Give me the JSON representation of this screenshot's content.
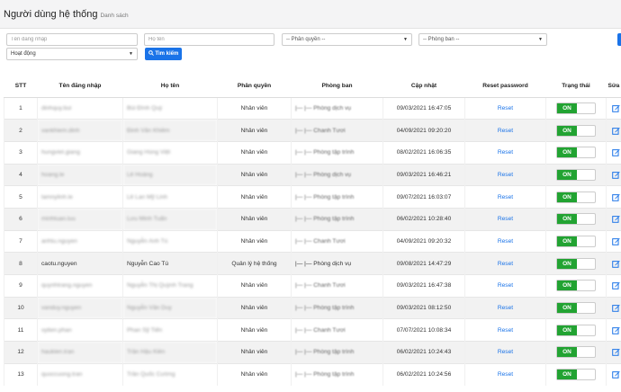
{
  "header": {
    "title": "Người dùng hệ thống",
    "subtitle": "Danh sách"
  },
  "filters": {
    "username_placeholder": "Tên đăng nhập",
    "fullname_placeholder": "Họ tên",
    "role_select": "-- Phân quyền --",
    "department_select": "-- Phòng ban --",
    "status_select": "Hoạt động",
    "search_label": "Tìm kiếm"
  },
  "table": {
    "headers": [
      "STT",
      "Tên đăng nhập",
      "Họ tên",
      "Phân quyền",
      "Phòng ban",
      "Cập nhật",
      "Reset password",
      "Trạng thái",
      "Sửa"
    ],
    "reset_label": "Reset",
    "status_label": "ON",
    "rows": [
      {
        "stt": "1",
        "username": "dinhquy.bui",
        "fullname": "Bùi Đình Quý",
        "role": "Nhân viên",
        "department": "|— |— Phòng dịch vụ",
        "updated": "09/03/2021 16:47:05"
      },
      {
        "stt": "2",
        "username": "vankhiem.dinh",
        "fullname": "Đinh Văn Khiêm",
        "role": "Nhân viên",
        "department": "|— |— Chanh Tươi",
        "updated": "04/09/2021 09:20:20"
      },
      {
        "stt": "3",
        "username": "hungviet.giang",
        "fullname": "Giang Hùng Việt",
        "role": "Nhân viên",
        "department": "|— |— Phòng tập trình",
        "updated": "08/02/2021 16:06:35"
      },
      {
        "stt": "4",
        "username": "hoang.le",
        "fullname": "Lê Hoàng",
        "role": "Nhân viên",
        "department": "|— |— Phòng dịch vụ",
        "updated": "09/03/2021 16:46:21"
      },
      {
        "stt": "5",
        "username": "lamnylinh.le",
        "fullname": "Lê Lan Mỹ Linh",
        "role": "Nhân viên",
        "department": "|— |— Phòng tập trình",
        "updated": "09/07/2021 16:03:07"
      },
      {
        "stt": "6",
        "username": "minhtuan.luu",
        "fullname": "Lưu Minh Tuấn",
        "role": "Nhân viên",
        "department": "|— |— Phòng tập trình",
        "updated": "06/02/2021 10:28:40"
      },
      {
        "stt": "7",
        "username": "anhtu.nguyen",
        "fullname": "Nguyễn Anh Tú",
        "role": "Nhân viên",
        "department": "|— |— Chanh Tươi",
        "updated": "04/09/2021 09:20:32"
      },
      {
        "stt": "8",
        "username": "caotu.nguyen",
        "fullname": "Nguyễn Cao Tú",
        "role": "Quản lý hệ thống",
        "department": "|— |— Phòng dịch vụ",
        "updated": "09/08/2021 14:47:29"
      },
      {
        "stt": "9",
        "username": "quynhtrang.nguyen",
        "fullname": "Nguyễn Thị Quỳnh Trang",
        "role": "Nhân viên",
        "department": "|— |— Chanh Tươi",
        "updated": "09/03/2021 16:47:38"
      },
      {
        "stt": "10",
        "username": "vanduy.nguyen",
        "fullname": "Nguyễn Văn Duy",
        "role": "Nhân viên",
        "department": "|— |— Phòng tập trình",
        "updated": "09/03/2021 08:12:50"
      },
      {
        "stt": "11",
        "username": "vytien.phan",
        "fullname": "Phan Sỹ Tiến",
        "role": "Nhân viên",
        "department": "|— |— Chanh Tươi",
        "updated": "07/07/2021 10:08:34"
      },
      {
        "stt": "12",
        "username": "haukien.tran",
        "fullname": "Trần Hậu Kiên",
        "role": "Nhân viên",
        "department": "|— |— Phòng tập trình",
        "updated": "06/02/2021 10:24:43"
      },
      {
        "stt": "13",
        "username": "quoccuong.tran",
        "fullname": "Trần Quốc Cường",
        "role": "Nhân viên",
        "department": "|— |— Phòng tập trình",
        "updated": "06/02/2021 10:24:56"
      }
    ]
  },
  "colors": {
    "primary": "#1a73e8",
    "on": "#22a332",
    "header_bg": "#f4f4f5"
  },
  "icons": {
    "search": "search-icon",
    "edit": "edit-icon"
  }
}
